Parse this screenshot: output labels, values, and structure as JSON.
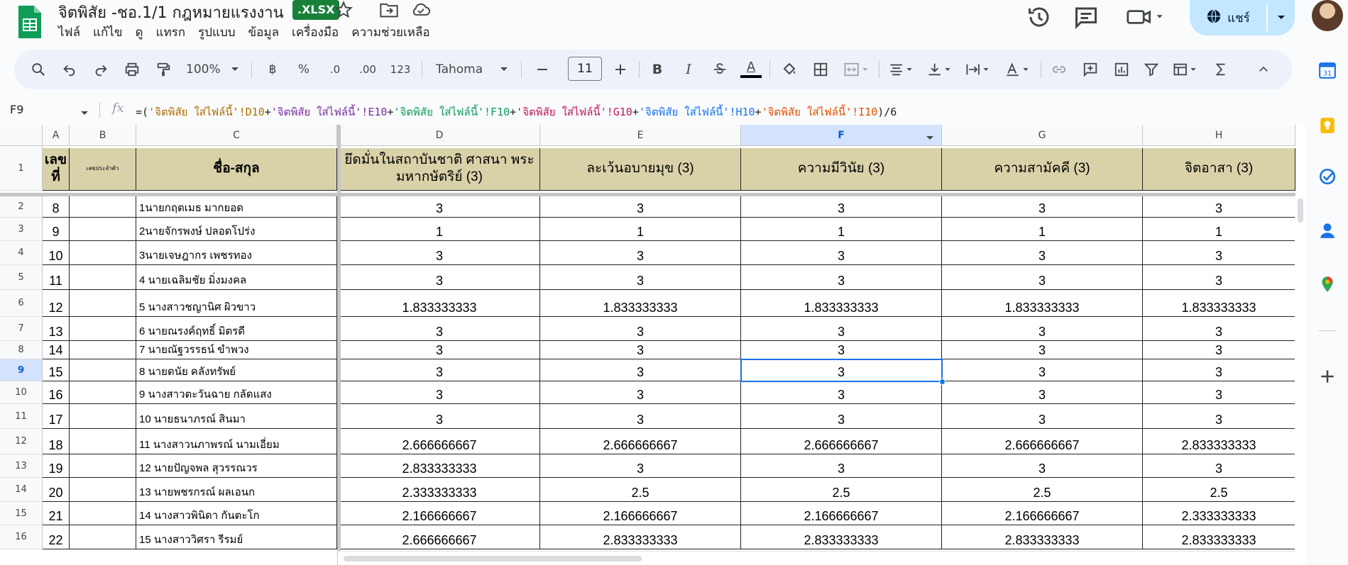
{
  "app": {
    "doc_title": "จิตพิสัย -ชอ.1/1 กฎหมายแรงงาน",
    "file_badge": ".XLSX",
    "menu": [
      "ไฟล์",
      "แก้ไข",
      "ดู",
      "แทรก",
      "รูปแบบ",
      "ข้อมูล",
      "เครื่องมือ",
      "ความช่วยเหลือ"
    ],
    "share_label": "แชร์"
  },
  "toolbar": {
    "zoom": "100%",
    "currency": "฿",
    "percent": "%",
    "decrease_decimal": ".0",
    "increase_decimal": ".00",
    "number_format": "123",
    "font": "Tahoma",
    "font_size": "11",
    "bold": "B",
    "italic": "I",
    "text_color": "A"
  },
  "formula_bar": {
    "cell_ref": "F9",
    "fx": "fx",
    "parts": [
      {
        "text": "=(",
        "cls": ""
      },
      {
        "text": "'จิตพิสัย ใส่ไฟล์นี้'!D10",
        "cls": "f-a"
      },
      {
        "text": "+",
        "cls": ""
      },
      {
        "text": "'จิตพิสัย ใส่ไฟล์นี้'!E10",
        "cls": "f-b"
      },
      {
        "text": "+",
        "cls": ""
      },
      {
        "text": "'จิตพิสัย ใส่ไฟล์นี้'!F10",
        "cls": "f-c"
      },
      {
        "text": "+",
        "cls": ""
      },
      {
        "text": "'จิตพิสัย ใส่ไฟล์นี้'!G10",
        "cls": "f-d"
      },
      {
        "text": "+",
        "cls": ""
      },
      {
        "text": "'จิตพิสัย ใส่ไฟล์นี้'!H10",
        "cls": "f-e"
      },
      {
        "text": "+",
        "cls": ""
      },
      {
        "text": "'จิตพิสัย ใส่ไฟล์นี้'!I10",
        "cls": "f-f"
      },
      {
        "text": ")/6",
        "cls": ""
      }
    ]
  },
  "sheet": {
    "columns": [
      "A",
      "B",
      "C",
      "D",
      "E",
      "F",
      "G",
      "H"
    ],
    "selected_column": "F",
    "selected_row": "9",
    "header_row": {
      "row_label": "1",
      "A": "เลขที่",
      "B": "เลขประจำตัว",
      "C": "ชื่อ-สกุล",
      "D": "ยึดมั่นในสถาบันชาติ ศาสนา พระมหากษัตริย์ (3)",
      "E": "ละเว้นอบายมุข (3)",
      "F": "ความมีวินัย (3)",
      "G": "ความสามัคคี (3)",
      "H": "จิตอาสา (3)"
    },
    "rows": [
      {
        "r": "2",
        "A": "8",
        "B": "",
        "C": "1นายกฤตเมธ  มากยอด",
        "D": "3",
        "E": "3",
        "F": "3",
        "G": "3",
        "H": "3"
      },
      {
        "r": "3",
        "A": "9",
        "B": "",
        "C": "2นายจักรพงษ์  ปลอดโปร่ง",
        "D": "1",
        "E": "1",
        "F": "1",
        "G": "1",
        "H": "1"
      },
      {
        "r": "4",
        "A": "10",
        "B": "",
        "C": "3นายเจษฎากร  เพชรทอง",
        "D": "3",
        "E": "3",
        "F": "3",
        "G": "3",
        "H": "3"
      },
      {
        "r": "5",
        "A": "11",
        "B": "",
        "C": "4 นายเฉลิมชัย  มิ่งมงคล",
        "D": "3",
        "E": "3",
        "F": "3",
        "G": "3",
        "H": "3"
      },
      {
        "r": "6",
        "A": "12",
        "B": "",
        "C": "5 นางสาวชญานิศ  ผิวขาว",
        "D": "1.833333333",
        "E": "1.833333333",
        "F": "1.833333333",
        "G": "1.833333333",
        "H": "1.833333333"
      },
      {
        "r": "7",
        "A": "13",
        "B": "",
        "C": "6 นายณรงค์ฤทธิ์  มิตรดี",
        "D": "3",
        "E": "3",
        "F": "3",
        "G": "3",
        "H": "3"
      },
      {
        "r": "8",
        "A": "14",
        "B": "",
        "C": "7 นายณัฐวรรธน์  ขำพวง",
        "D": "3",
        "E": "3",
        "F": "3",
        "G": "3",
        "H": "3"
      },
      {
        "r": "9",
        "A": "15",
        "B": "",
        "C": "8 นายดนัย  คลังทรัพย์",
        "D": "3",
        "E": "3",
        "F": "3",
        "G": "3",
        "H": "3"
      },
      {
        "r": "10",
        "A": "16",
        "B": "",
        "C": "9 นางสาวตะวันฉาย  กลัดแสง",
        "D": "3",
        "E": "3",
        "F": "3",
        "G": "3",
        "H": "3"
      },
      {
        "r": "11",
        "A": "17",
        "B": "",
        "C": "10 นายธนาภรณ์ สินมา",
        "D": "3",
        "E": "3",
        "F": "3",
        "G": "3",
        "H": "3"
      },
      {
        "r": "12",
        "A": "18",
        "B": "",
        "C": "11 นางสาวนภาพรณ์  นามเอี่ยม",
        "D": "2.666666667",
        "E": "2.666666667",
        "F": "2.666666667",
        "G": "2.666666667",
        "H": "2.833333333"
      },
      {
        "r": "13",
        "A": "19",
        "B": "",
        "C": "12 นายปัญจพล  สุวรรณวร",
        "D": "2.833333333",
        "E": "3",
        "F": "3",
        "G": "3",
        "H": "3"
      },
      {
        "r": "14",
        "A": "20",
        "B": "",
        "C": "13 นายพชรกรณ์   ผลเอนก",
        "D": "2.333333333",
        "E": "2.5",
        "F": "2.5",
        "G": "2.5",
        "H": "2.5"
      },
      {
        "r": "15",
        "A": "21",
        "B": "",
        "C": "14 นางสาวพินิดา  กันตะโก",
        "D": "2.166666667",
        "E": "2.166666667",
        "F": "2.166666667",
        "G": "2.166666667",
        "H": "2.333333333"
      },
      {
        "r": "16",
        "A": "22",
        "B": "",
        "C": "15 นางสาววิศรา  รีรมย์",
        "D": "2.666666667",
        "E": "2.833333333",
        "F": "2.833333333",
        "G": "2.833333333",
        "H": "2.833333333"
      }
    ]
  },
  "colors": {
    "header_fill": "#d9d2a9",
    "selection": "#1a73e8",
    "toolbar_bg": "#edf2fa",
    "share_bg": "#c2e7ff",
    "badge_green": "#188038"
  }
}
